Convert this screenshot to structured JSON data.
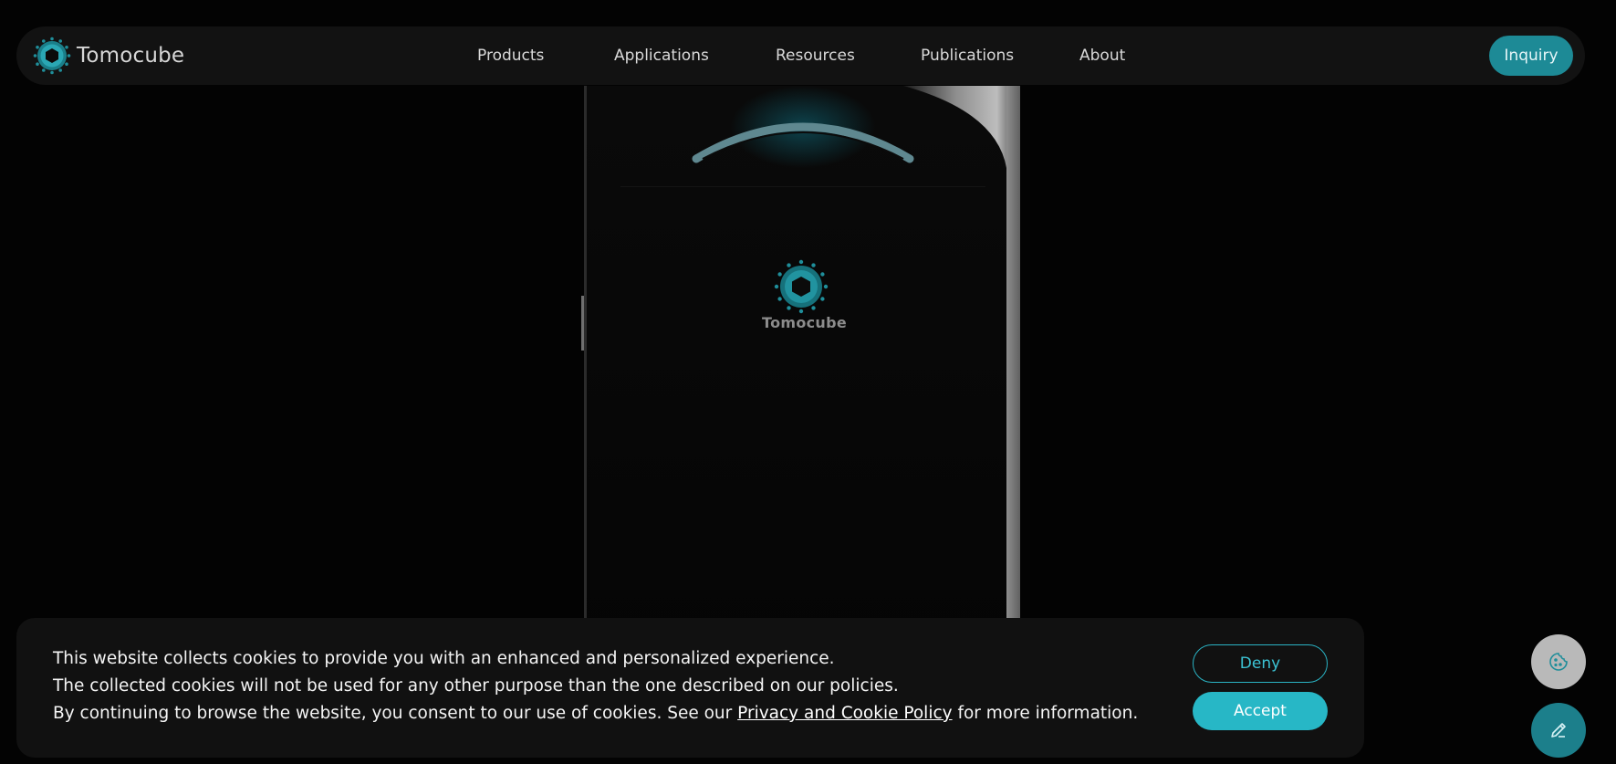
{
  "brand": {
    "name": "Tomocube",
    "accent_color": "#1d8a96",
    "logo_icon": "hexagon-logo-icon"
  },
  "nav": {
    "items": [
      {
        "label": "Products"
      },
      {
        "label": "Applications"
      },
      {
        "label": "Resources"
      },
      {
        "label": "Publications"
      },
      {
        "label": "About"
      }
    ],
    "inquiry_label": "Inquiry"
  },
  "hero": {
    "device_brand": "Tomocube"
  },
  "cookie_banner": {
    "line1": "This website collects cookies to provide you with an enhanced and personalized experience.",
    "line2": "The collected cookies will not be used for any other purpose than the one described on our policies.",
    "line3_before": "By continuing to browse the website, you consent to our use of cookies. See our ",
    "link_text": "Privacy and Cookie Policy",
    "line3_after": " for more information.",
    "deny_label": "Deny",
    "accept_label": "Accept",
    "button_color": "#27b7c6"
  },
  "floating": {
    "cookie_settings_icon": "cookie-icon",
    "edit_icon": "pencil-icon"
  }
}
